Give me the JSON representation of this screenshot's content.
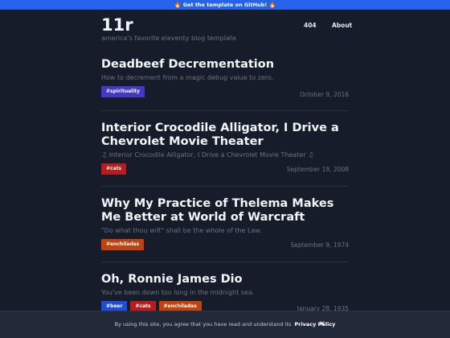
{
  "banner": {
    "text": "Get the template on GitHub!",
    "icon": "🔥",
    "color": "#2563eb"
  },
  "header": {
    "title": "11r",
    "tagline": "america's favorite eleventy blog template",
    "nav": [
      {
        "label": "404"
      },
      {
        "label": "About"
      }
    ]
  },
  "posts": [
    {
      "title": "Deadbeef Decrementation",
      "excerpt": "How to decrement from a magic debug value to zero.",
      "tags": [
        {
          "label": "#spirituality",
          "color": "#4338ca"
        }
      ],
      "date": "October 9, 2016"
    },
    {
      "title": "Interior Crocodile Alligator, I Drive a Chevrolet Movie Theater",
      "excerpt": "♫ Interior Crocodile Alligator, I Drive a Chevrolet Movie Theater ♫",
      "tags": [
        {
          "label": "#cats",
          "color": "#b91c1c"
        }
      ],
      "date": "September 19, 2008"
    },
    {
      "title": "Why My Practice of Thelema Makes Me Better at World of Warcraft",
      "excerpt": "\"Do what thou wilt\" shall be the whole of the Law.",
      "tags": [
        {
          "label": "#enchiladas",
          "color": "#c2410c"
        }
      ],
      "date": "September 9, 1974"
    },
    {
      "title": "Oh, Ronnie James Dio",
      "excerpt": "You've been down too long in the midnight sea.",
      "tags": [
        {
          "label": "#beer",
          "color": "#1d4ed8"
        },
        {
          "label": "#cats",
          "color": "#b91c1c"
        },
        {
          "label": "#enchiladas",
          "color": "#c2410c"
        }
      ],
      "date": "January 28, 1935"
    }
  ],
  "cookie_notice": {
    "text": "By using this site, you agree that you have read and understand its",
    "link_label": "Privacy Policy",
    "close_label": "✕"
  }
}
